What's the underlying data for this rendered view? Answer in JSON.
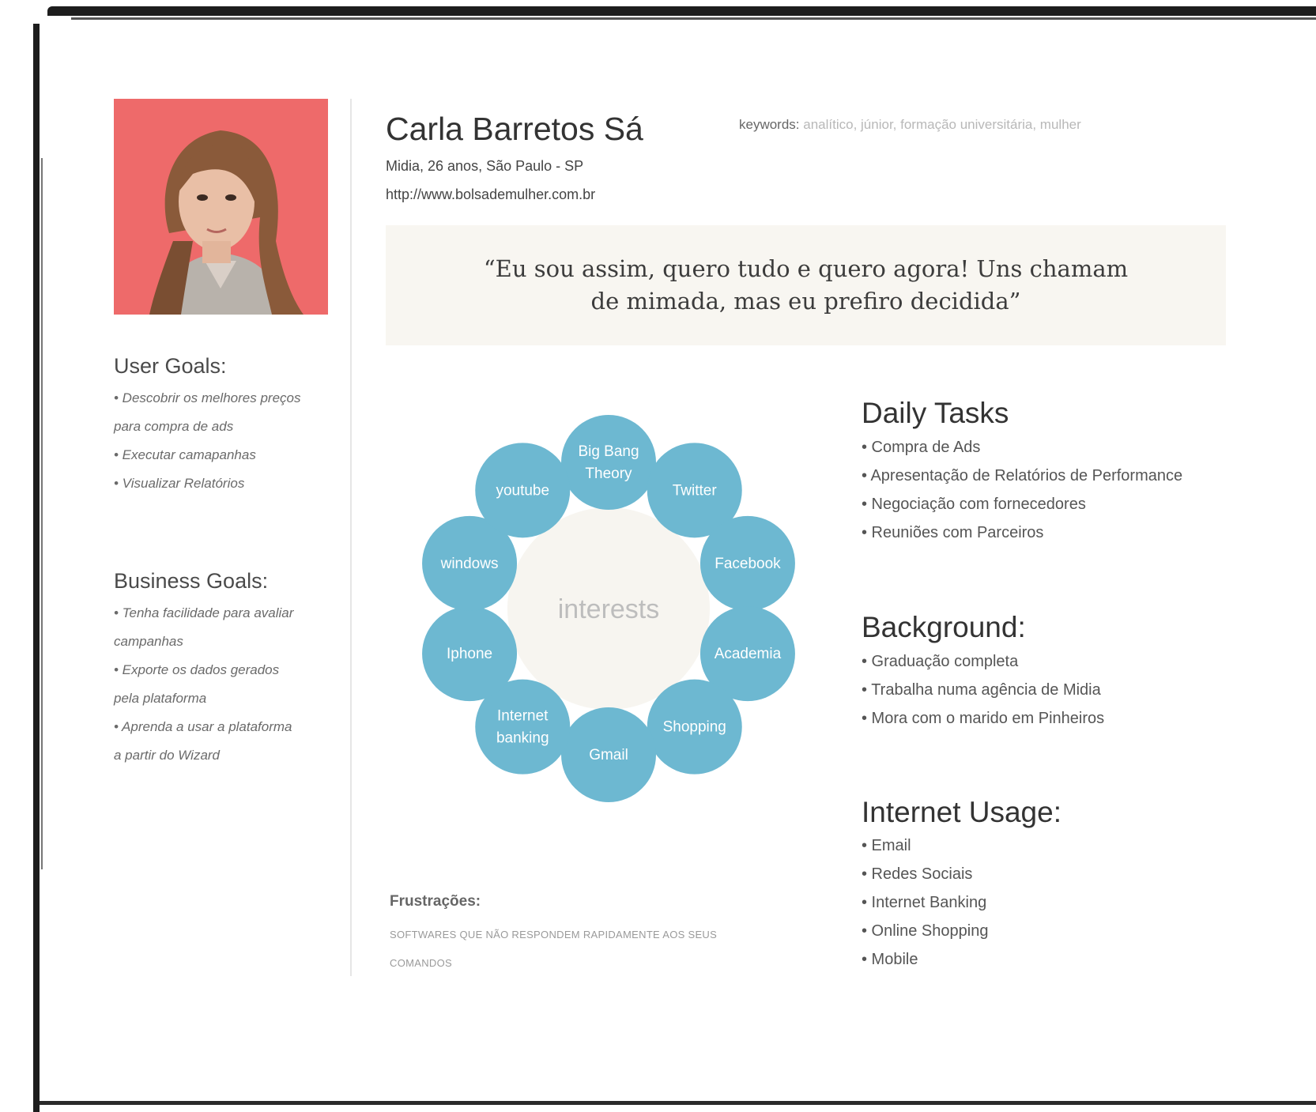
{
  "persona": {
    "name": "Carla Barretos Sá",
    "details": "Midia, 26 anos, São Paulo - SP",
    "url": "http://www.bolsademulher.com.br",
    "keywords_label": "keywords:",
    "keywords": "analítico, júnior, formação universitária, mulher",
    "quote": "“Eu sou assim, quero tudo e quero agora! Uns chamam de mimada, mas eu prefiro decidida”"
  },
  "user_goals": {
    "title": "User Goals:",
    "items": [
      "• Descobrir os melhores preços",
      "para compra de ads",
      "• Executar camapanhas",
      "• Visualizar Relatórios"
    ]
  },
  "business_goals": {
    "title": "Business Goals:",
    "items": [
      "• Tenha facilidade para avaliar",
      "campanhas",
      "• Exporte os dados gerados",
      "pela plataforma",
      "• Aprenda a usar a plataforma",
      "a partir do Wizard"
    ]
  },
  "interests": {
    "center_label": "interests",
    "items": [
      {
        "label": "Big Bang Theory"
      },
      {
        "label": "Twitter"
      },
      {
        "label": "Facebook"
      },
      {
        "label": "Academia"
      },
      {
        "label": "Shopping"
      },
      {
        "label": "Gmail"
      },
      {
        "label": "Internet banking"
      },
      {
        "label": "Iphone"
      },
      {
        "label": "windows"
      },
      {
        "label": "youtube"
      }
    ],
    "bubble_color": "#6db8d1",
    "center_color": "#f7f5f0"
  },
  "daily_tasks": {
    "title": "Daily Tasks",
    "items": [
      "• Compra de Ads",
      "• Apresentação de Relatórios de Performance",
      "• Negociação com fornecedores",
      "• Reuniões com Parceiros"
    ]
  },
  "background": {
    "title": "Background:",
    "items": [
      "• Graduação completa",
      "• Trabalha numa agência de Midia",
      "• Mora com o marido em Pinheiros"
    ]
  },
  "internet_usage": {
    "title": "Internet Usage:",
    "items": [
      "• Email",
      "• Redes Sociais",
      "• Internet Banking",
      "• Online Shopping",
      "• Mobile"
    ]
  },
  "frustrations": {
    "title": "Frustrações:",
    "text": "SOFTWARES QUE NÃO RESPONDEM RAPIDAMENTE AOS SEUS COMANDOS"
  }
}
